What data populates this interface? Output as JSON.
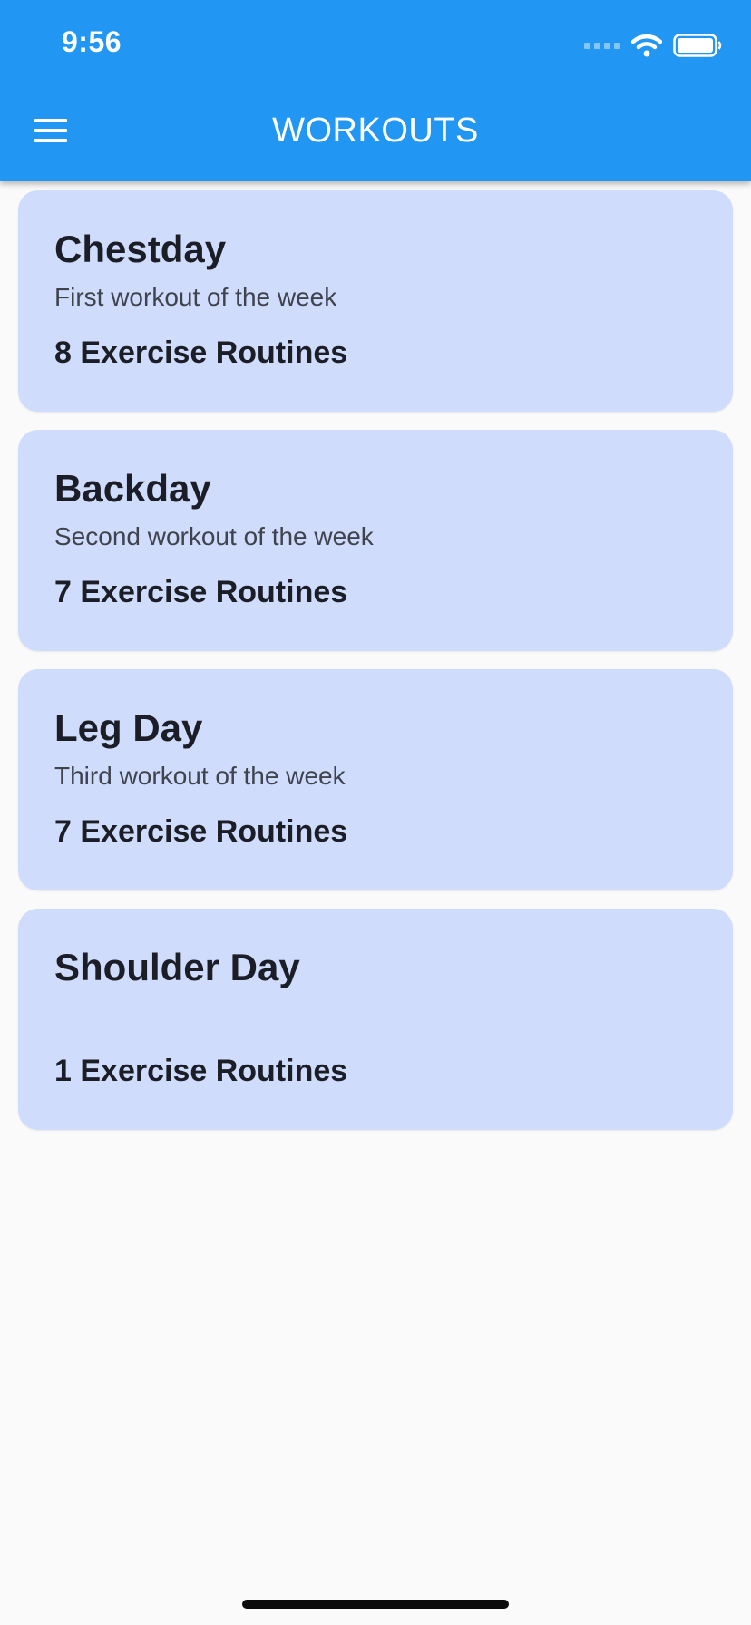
{
  "status_bar": {
    "time": "9:56",
    "icons": [
      "cellular-signal-icon",
      "wifi-icon",
      "battery-icon"
    ]
  },
  "app_bar": {
    "title": "WORKOUTS",
    "menu_icon": "hamburger-menu-icon",
    "color": "#2196f3"
  },
  "workouts": [
    {
      "title": "Chestday",
      "subtitle": "First workout of the week",
      "routines": "8 Exercise Routines"
    },
    {
      "title": "Backday",
      "subtitle": "Second workout of the week",
      "routines": "7 Exercise Routines"
    },
    {
      "title": "Leg Day",
      "subtitle": "Third workout of the week",
      "routines": "7 Exercise Routines"
    },
    {
      "title": "Shoulder Day",
      "subtitle": "",
      "routines": "1 Exercise Routines"
    }
  ],
  "colors": {
    "card_background": "#d0dcfb",
    "page_background": "#fafafa"
  }
}
